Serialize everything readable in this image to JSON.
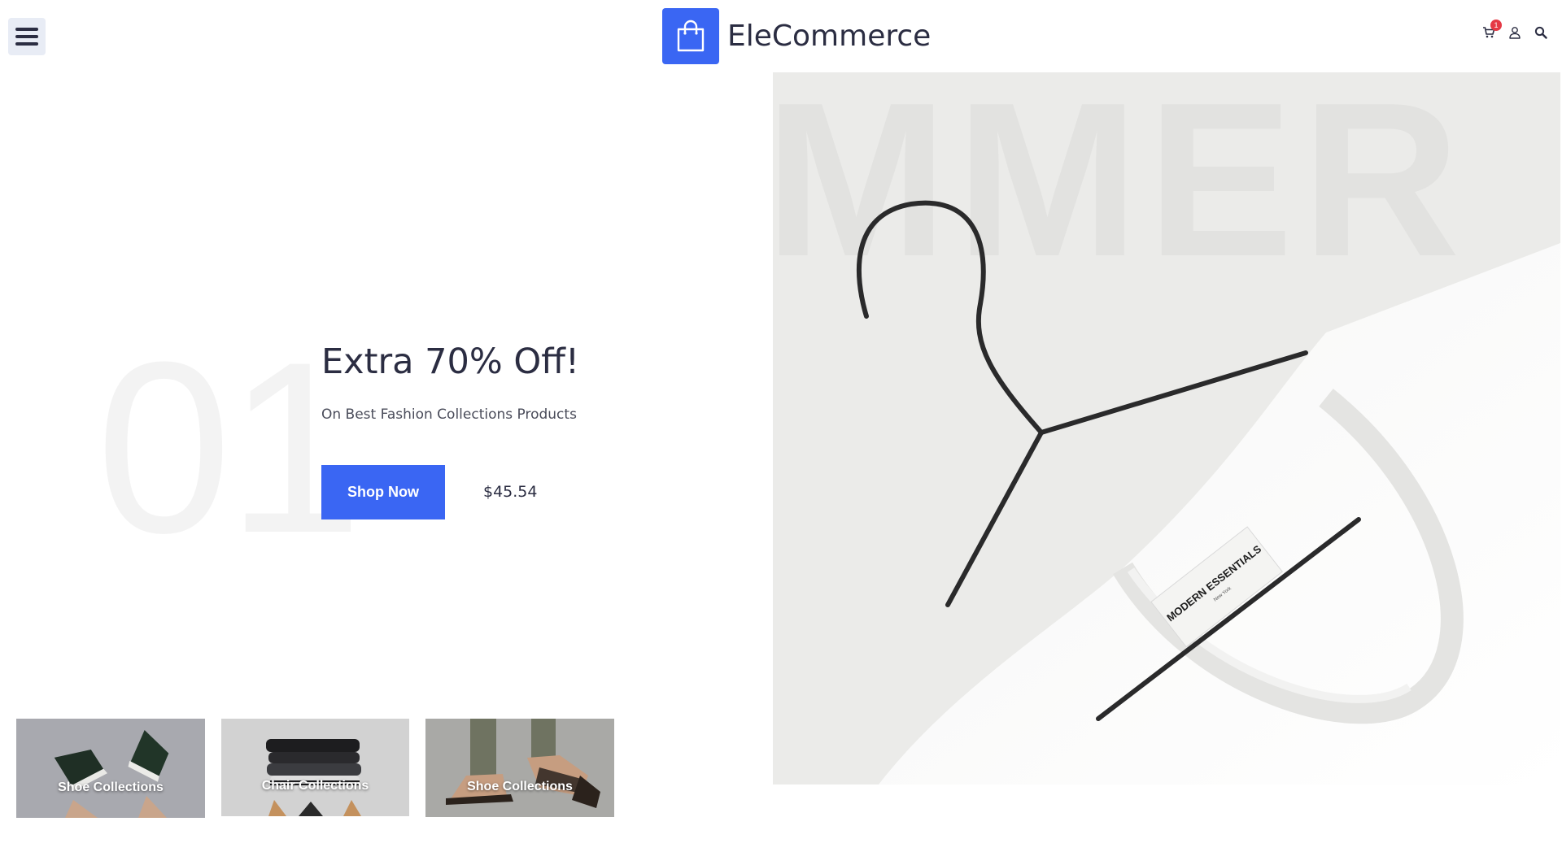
{
  "header": {
    "brand": "EleCommerce",
    "cart_count": "1",
    "icons": [
      "menu-icon",
      "shopping-bag-icon",
      "cart-icon",
      "user-icon",
      "search-icon"
    ]
  },
  "hero": {
    "number": "01",
    "title": "Extra 70% Off!",
    "subtitle": "On Best Fashion Collections Products",
    "button": "Shop Now",
    "price": "$45.54",
    "image": {
      "background_word": "MMER",
      "label_main": "MODERN ESSENTIALS",
      "label_sub": "New York"
    }
  },
  "collections": [
    {
      "label": "Shoe Collections"
    },
    {
      "label": "Chair Collections"
    },
    {
      "label": "Shoe Collections"
    }
  ],
  "colors": {
    "accent": "#3a66f3",
    "text": "#2b2d42",
    "badge": "#e53945"
  }
}
